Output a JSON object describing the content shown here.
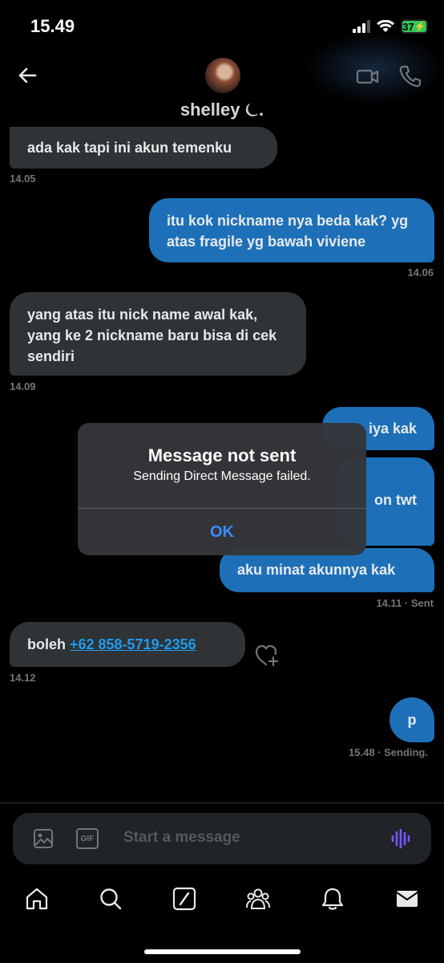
{
  "status_bar": {
    "time": "15.49",
    "battery": "37"
  },
  "header": {
    "contact_name": "shelley ⏾."
  },
  "messages": [
    {
      "text": "ada kak tapi ini akun temenku",
      "time": "14.05"
    },
    {
      "text": "itu kok nickname nya beda kak? yg atas fragile yg bawah viviene",
      "time": "14.06"
    },
    {
      "text": "yang atas itu nick name awal kak, yang ke 2 nickname baru bisa di cek sendiri",
      "time": "14.09"
    },
    {
      "text": "iya kak"
    },
    {
      "text": "on twt"
    },
    {
      "text": "aku minat akunnya kak",
      "time": "14.11 · Sent"
    },
    {
      "text_prefix": "boleh ",
      "link": "+62 858-5719-2356",
      "time": "14.12"
    },
    {
      "text": "p",
      "time": "15.48 · Sending."
    }
  ],
  "dialog": {
    "title": "Message not sent",
    "message": "Sending Direct Message failed.",
    "ok": "OK"
  },
  "composer": {
    "placeholder": "Start a message",
    "gif": "GIF"
  },
  "colors": {
    "outgoing": "#1d70b8",
    "incoming": "#2f3336",
    "accent": "#3b8bff"
  }
}
